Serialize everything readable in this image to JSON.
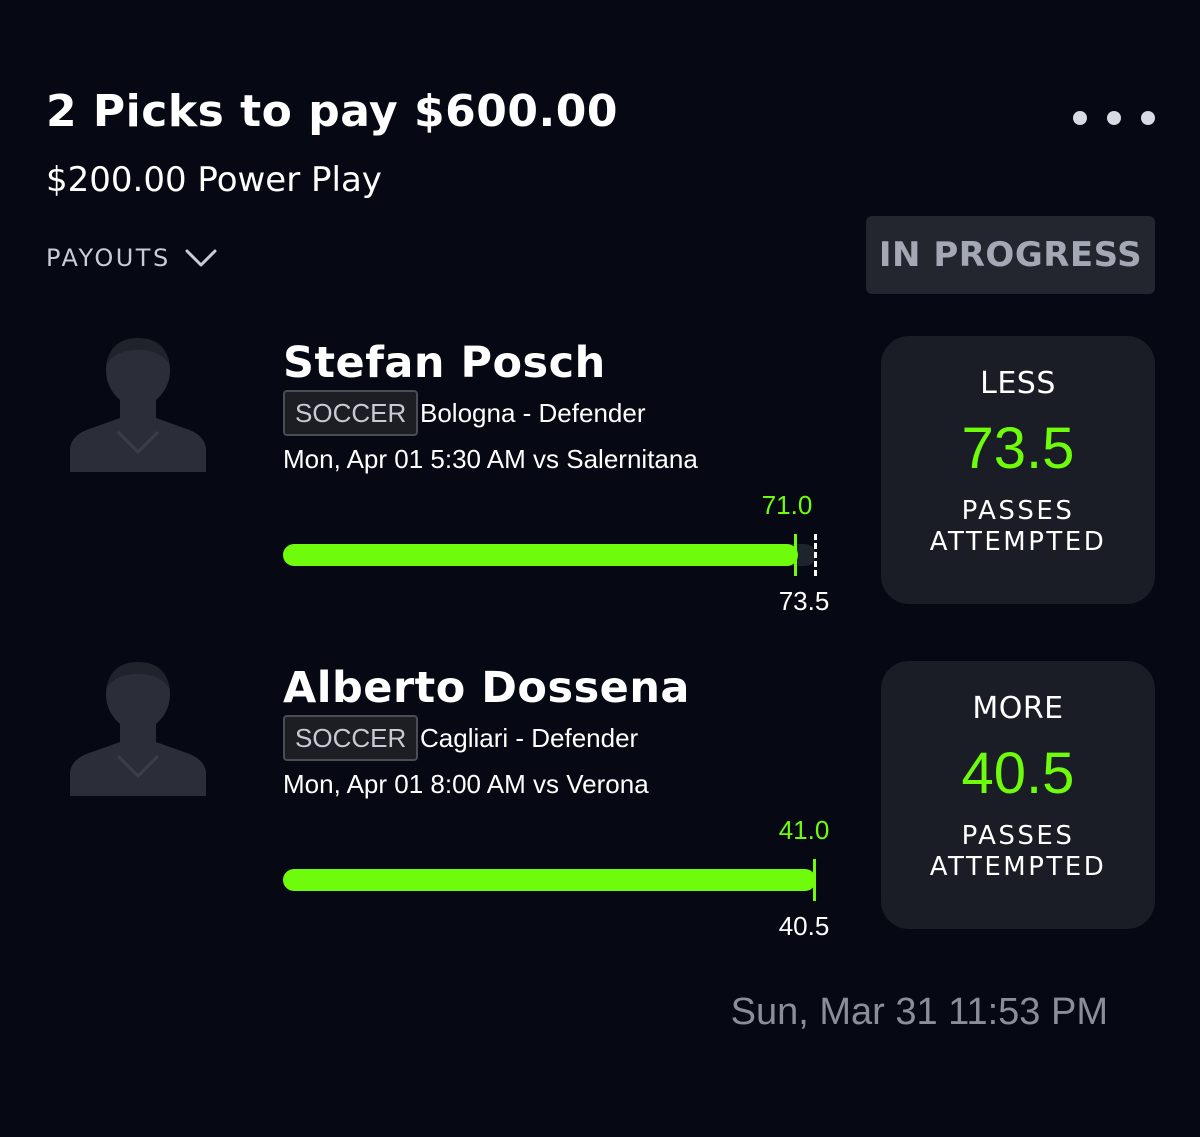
{
  "header": {
    "title": "2 Picks to pay $600.00",
    "subtitle": "$200.00 Power Play",
    "more_icon": "ellipsis-horizontal-icon",
    "payouts_label": "PAYOUTS",
    "payouts_icon": "chevron-down-icon",
    "status": "IN PROGRESS"
  },
  "picks": [
    {
      "player": "Stefan Posch",
      "sport": "SOCCER",
      "team_position": "Bologna - Defender",
      "game": "Mon, Apr 01 5:30 AM  vs Salernitana",
      "current": "71.0",
      "line": "73.5",
      "progress": 0.966,
      "direction": "LESS",
      "stat": "PASSES\nATTEMPTED"
    },
    {
      "player": "Alberto Dossena",
      "sport": "SOCCER",
      "team_position": "Cagliari - Defender",
      "game": "Mon, Apr 01 8:00 AM  vs Verona",
      "current": "41.0",
      "line": "40.5",
      "progress": 1.0,
      "direction": "MORE",
      "stat": "PASSES\nATTEMPTED"
    }
  ],
  "footer": {
    "timestamp": "Sun, Mar 31 11:53 PM"
  },
  "colors": {
    "background": "#060913",
    "accent_green": "#6efc0c",
    "card": "#1a1d26",
    "badge": "#23262f"
  }
}
